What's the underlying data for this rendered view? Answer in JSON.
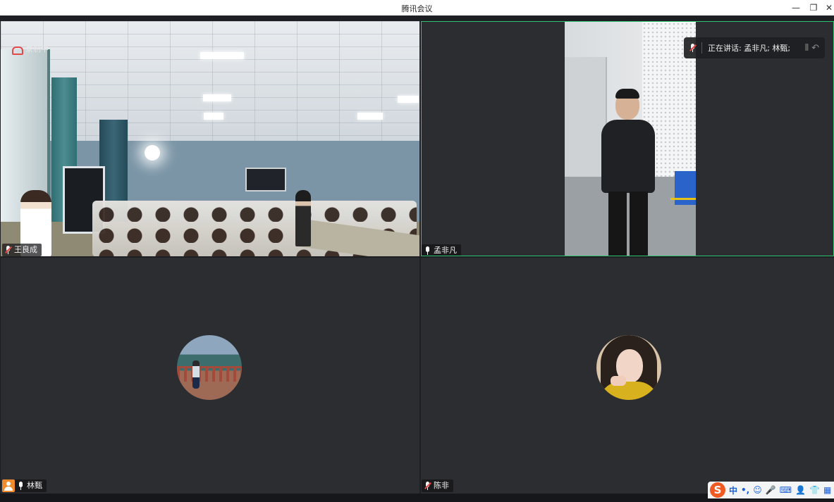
{
  "window": {
    "title": "腾讯会议",
    "min_glyph": "—",
    "max_glyph": "❐",
    "close_glyph": "✕"
  },
  "tiles": [
    {
      "name": "王良成",
      "recording_label": "录制中",
      "mic": "muted"
    },
    {
      "name": "孟非凡",
      "mic": "on",
      "active_speaker": true,
      "speaking_label": "正在讲话: 孟非凡; 林甄;"
    },
    {
      "name": "林甄",
      "mic": "on",
      "host_badge": true
    },
    {
      "name": "陈非",
      "mic": "muted"
    }
  ],
  "ime": {
    "logo": "S",
    "items": [
      "中",
      "•,",
      "☺",
      "🎤",
      "⌨",
      "👤",
      "👕",
      "▦"
    ]
  },
  "colors": {
    "active_border": "#2ec472",
    "recording": "#e54848",
    "host_badge": "#f08c2e",
    "tile_bg": "#2b2d31"
  }
}
